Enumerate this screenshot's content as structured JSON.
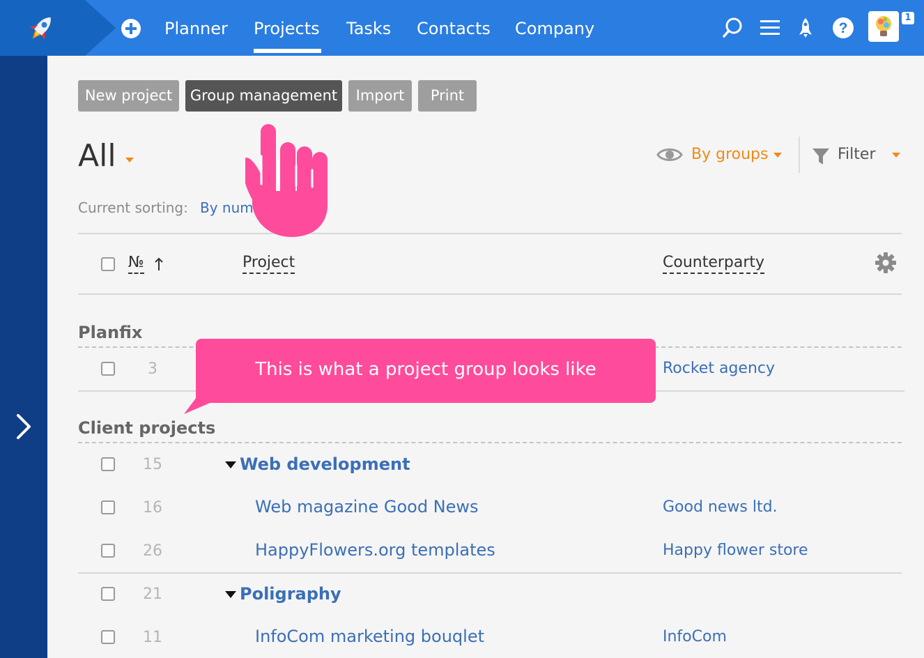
{
  "nav": {
    "items": [
      "Planner",
      "Projects",
      "Tasks",
      "Contacts",
      "Company"
    ],
    "notification_count": "1"
  },
  "toolbar": {
    "new_project": "New project",
    "group_management": "Group management",
    "import": "Import",
    "print": "Print"
  },
  "view": {
    "title": "All",
    "by_groups": "By groups",
    "filter": "Filter",
    "sorting_label": "Current sorting:",
    "sorting_value": "By num"
  },
  "table": {
    "col_num": "№",
    "col_project": "Project",
    "col_counterparty": "Counterparty"
  },
  "groups": {
    "planfix": {
      "label": "Planfix",
      "rows": [
        {
          "num": "3",
          "counterparty": "Rocket agency"
        }
      ]
    },
    "client": {
      "label": "Client projects",
      "rows": [
        {
          "num": "15",
          "project": "Web development",
          "counterparty": ""
        },
        {
          "num": "16",
          "project": "Web magazine Good News",
          "counterparty": "Good news ltd."
        },
        {
          "num": "26",
          "project": "HappyFlowers.org templates",
          "counterparty": "Happy flower store"
        },
        {
          "num": "21",
          "project": "Poligraphy",
          "counterparty": ""
        },
        {
          "num": "11",
          "project": "InfoCom marketing bouqlet",
          "counterparty": "InfoCom"
        }
      ]
    }
  },
  "tooltip": {
    "text": "This is what a project group looks like"
  },
  "colors": {
    "topbar": "#2a7de1",
    "sidebar": "#0f3e86",
    "accent_orange": "#f08a16",
    "pink": "#ff4b9b",
    "link": "#3b6fb6"
  }
}
